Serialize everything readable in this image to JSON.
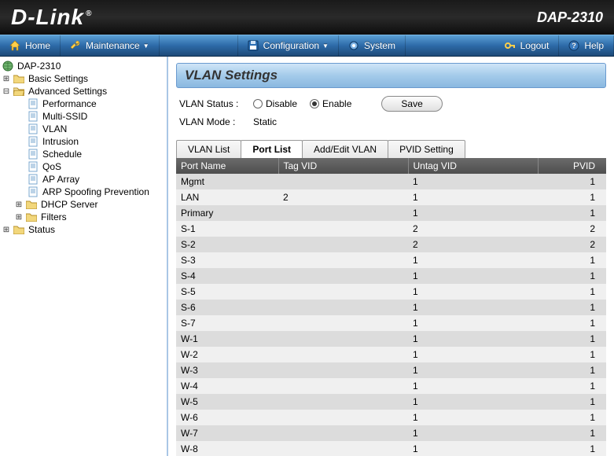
{
  "header": {
    "brand": "D-Link",
    "model": "DAP-2310"
  },
  "nav": {
    "home": "Home",
    "maintenance": "Maintenance",
    "configuration": "Configuration",
    "system": "System",
    "logout": "Logout",
    "help": "Help"
  },
  "tree": {
    "root": "DAP-2310",
    "basic": "Basic Settings",
    "advanced": "Advanced Settings",
    "performance": "Performance",
    "multissid": "Multi-SSID",
    "vlan": "VLAN",
    "intrusion": "Intrusion",
    "schedule": "Schedule",
    "qos": "QoS",
    "aparray": "AP Array",
    "arp": "ARP Spoofing Prevention",
    "dhcp": "DHCP Server",
    "filters": "Filters",
    "status": "Status"
  },
  "page": {
    "title": "VLAN Settings",
    "status_label": "VLAN Status  :",
    "disable": "Disable",
    "enable": "Enable",
    "mode_label": "VLAN Mode  :",
    "mode_value": "Static",
    "save": "Save",
    "tabs": {
      "vlanlist": "VLAN List",
      "portlist": "Port List",
      "addedit": "Add/Edit VLAN",
      "pvid": "PVID Setting"
    },
    "columns": {
      "port": "Port Name",
      "tag": "Tag VID",
      "untag": "Untag VID",
      "pvid": "PVID"
    },
    "rows": [
      {
        "port": "Mgmt",
        "tag": "",
        "untag": "1",
        "pvid": "1"
      },
      {
        "port": "LAN",
        "tag": "2",
        "untag": "1",
        "pvid": "1"
      },
      {
        "port": "Primary",
        "tag": "",
        "untag": "1",
        "pvid": "1"
      },
      {
        "port": "S-1",
        "tag": "",
        "untag": "2",
        "pvid": "2"
      },
      {
        "port": "S-2",
        "tag": "",
        "untag": "2",
        "pvid": "2"
      },
      {
        "port": "S-3",
        "tag": "",
        "untag": "1",
        "pvid": "1"
      },
      {
        "port": "S-4",
        "tag": "",
        "untag": "1",
        "pvid": "1"
      },
      {
        "port": "S-5",
        "tag": "",
        "untag": "1",
        "pvid": "1"
      },
      {
        "port": "S-6",
        "tag": "",
        "untag": "1",
        "pvid": "1"
      },
      {
        "port": "S-7",
        "tag": "",
        "untag": "1",
        "pvid": "1"
      },
      {
        "port": "W-1",
        "tag": "",
        "untag": "1",
        "pvid": "1"
      },
      {
        "port": "W-2",
        "tag": "",
        "untag": "1",
        "pvid": "1"
      },
      {
        "port": "W-3",
        "tag": "",
        "untag": "1",
        "pvid": "1"
      },
      {
        "port": "W-4",
        "tag": "",
        "untag": "1",
        "pvid": "1"
      },
      {
        "port": "W-5",
        "tag": "",
        "untag": "1",
        "pvid": "1"
      },
      {
        "port": "W-6",
        "tag": "",
        "untag": "1",
        "pvid": "1"
      },
      {
        "port": "W-7",
        "tag": "",
        "untag": "1",
        "pvid": "1"
      },
      {
        "port": "W-8",
        "tag": "",
        "untag": "1",
        "pvid": "1"
      }
    ]
  }
}
